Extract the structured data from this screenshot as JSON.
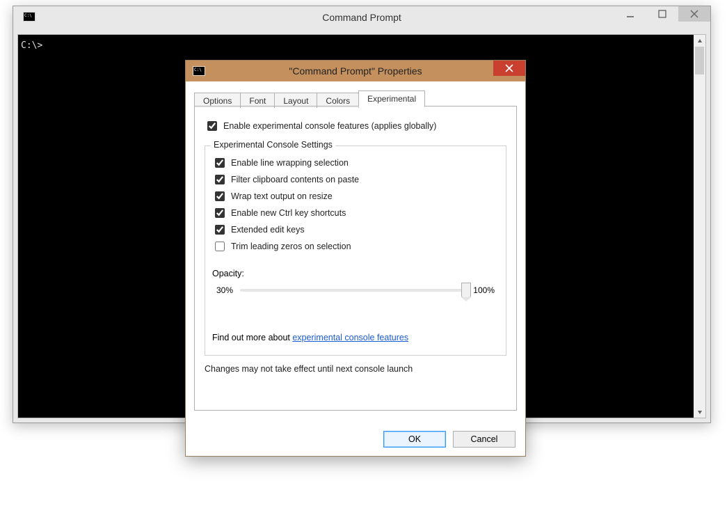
{
  "main_window": {
    "title": "Command Prompt",
    "prompt_text": "C:\\>"
  },
  "dialog": {
    "title": "\"Command Prompt\" Properties",
    "tabs": [
      "Options",
      "Font",
      "Layout",
      "Colors",
      "Experimental"
    ],
    "active_tab_index": 4,
    "global_checkbox": {
      "label": "Enable experimental console features (applies globally)",
      "checked": true
    },
    "group": {
      "legend": "Experimental Console Settings",
      "items": [
        {
          "label": "Enable line wrapping selection",
          "checked": true
        },
        {
          "label": "Filter clipboard contents on paste",
          "checked": true
        },
        {
          "label": "Wrap text output on resize",
          "checked": true
        },
        {
          "label": "Enable new Ctrl key shortcuts",
          "checked": true
        },
        {
          "label": "Extended edit keys",
          "checked": true
        },
        {
          "label": "Trim leading zeros on selection",
          "checked": false
        }
      ],
      "opacity_label": "Opacity:",
      "opacity_min_label": "30%",
      "opacity_max_label": "100%",
      "opacity_value_percent": 100,
      "link_prefix": "Find out more about ",
      "link_text": "experimental console features"
    },
    "footnote": "Changes may not take effect until next console launch",
    "buttons": {
      "ok": "OK",
      "cancel": "Cancel"
    }
  }
}
